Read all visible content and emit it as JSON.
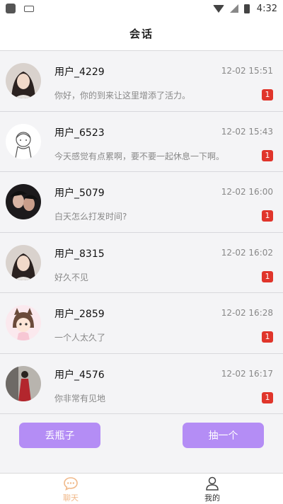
{
  "status_bar": {
    "time": "4:32"
  },
  "header": {
    "title": "会话"
  },
  "conversations": [
    {
      "name": "用户_4229",
      "time": "12-02 15:51",
      "message": "你好，你的到来让这里增添了活力。",
      "unread": "1",
      "avatar": "woman-portrait"
    },
    {
      "name": "用户_6523",
      "time": "12-02 15:43",
      "message": "今天感觉有点累啊，要不要一起休息一下啊。",
      "unread": "1",
      "avatar": "sketch-girl"
    },
    {
      "name": "用户_5079",
      "time": "12-02 16:00",
      "message": "白天怎么打发时间?",
      "unread": "1",
      "avatar": "couple-photo"
    },
    {
      "name": "用户_8315",
      "time": "12-02 16:02",
      "message": "好久不见",
      "unread": "1",
      "avatar": "woman-portrait"
    },
    {
      "name": "用户_2859",
      "time": "12-02 16:28",
      "message": "一个人太久了",
      "unread": "1",
      "avatar": "cartoon-cat-girl"
    },
    {
      "name": "用户_4576",
      "time": "12-02 16:17",
      "message": "你非常有见地",
      "unread": "1",
      "avatar": "woman-red-dress"
    }
  ],
  "actions": {
    "throw_label": "丢瓶子",
    "pick_label": "抽一个"
  },
  "tabbar": {
    "chat_label": "聊天",
    "me_label": "我的"
  },
  "colors": {
    "accent": "#b48df5",
    "badge": "#e0352b",
    "active_tab": "#f0b98a"
  }
}
